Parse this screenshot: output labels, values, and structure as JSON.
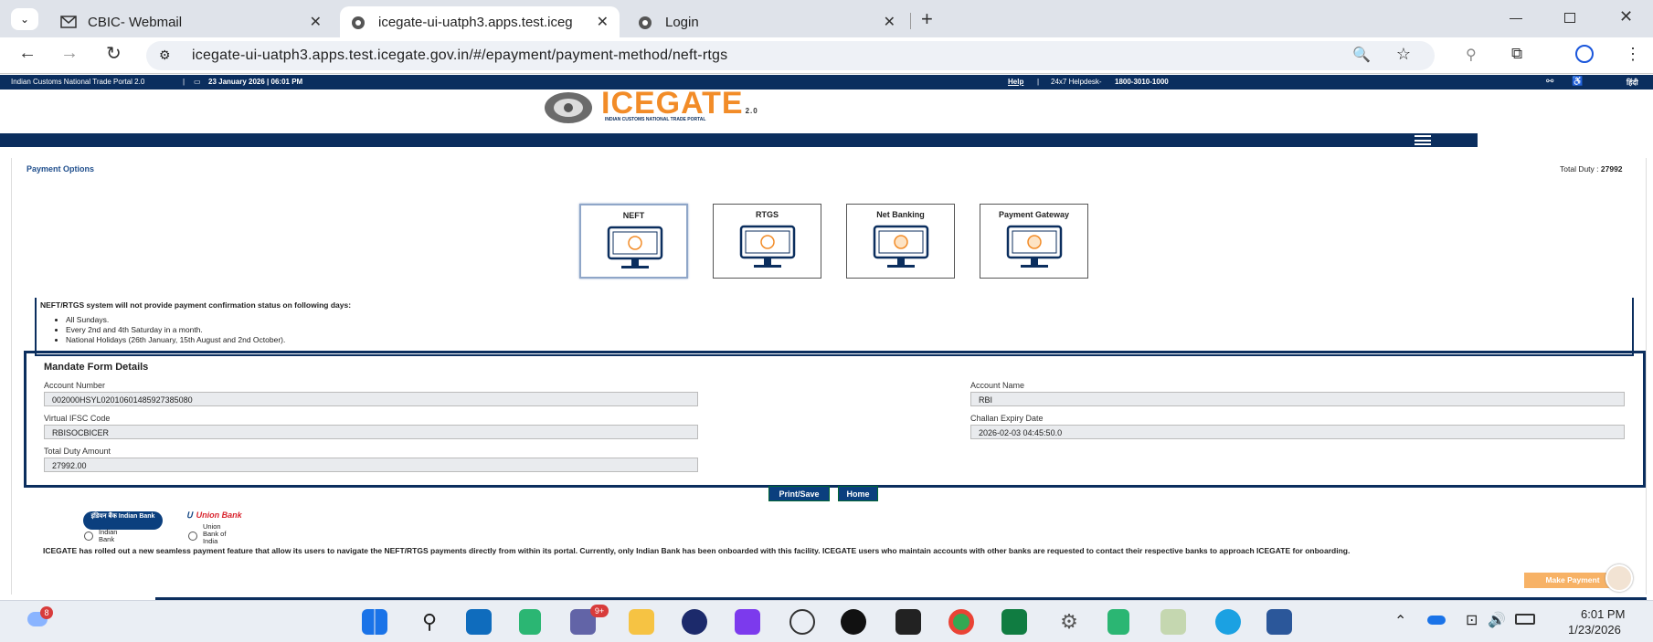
{
  "browser": {
    "tabs": [
      {
        "title": "CBIC- Webmail",
        "active": false
      },
      {
        "title": "icegate-ui-uatph3.apps.test.iceg",
        "active": true
      },
      {
        "title": "Login",
        "active": false
      }
    ],
    "new_tab": "+",
    "url": "icegate-ui-uatph3.apps.test.icegate.gov.in/#/epayment/payment-method/neft-rtgs"
  },
  "topbar": {
    "portal": "Indian Customs National Trade Portal 2.0",
    "date": "23 January 2026 | 06:01 PM",
    "help": "Help",
    "helpdesk_label": "24x7 Helpdesk-",
    "helpdesk_number": "1800-3010-1000",
    "lang": "हिंदी"
  },
  "header": {
    "logo_text": "ICEGATE",
    "logo_ver": "2.0",
    "logo_sub": "INDIAN CUSTOMS NATIONAL TRADE PORTAL"
  },
  "page": {
    "section_title": "Payment Options",
    "total_duty_label": "Total Duty : ",
    "total_duty_value": "27992",
    "methods": [
      {
        "label": "NEFT",
        "selected": true
      },
      {
        "label": "RTGS",
        "selected": false
      },
      {
        "label": "Net Banking",
        "selected": false
      },
      {
        "label": "Payment Gateway",
        "selected": false
      }
    ],
    "notice": {
      "heading": "NEFT/RTGS system will not provide payment confirmation status on following days:",
      "items": [
        "All Sundays.",
        "Every 2nd and 4th Saturday in a month.",
        "National Holidays (26th January, 15th August and 2nd October)."
      ]
    },
    "mandate": {
      "title": "Mandate Form Details",
      "account_number_label": "Account Number",
      "account_number": "002000HSYL02010601485927385080",
      "account_name_label": "Account Name",
      "account_name": "RBI",
      "ifsc_label": "Virtual IFSC Code",
      "ifsc": "RBISOCBICER",
      "expiry_label": "Challan Expiry Date",
      "expiry": "2026-02-03 04:45:50.0",
      "amount_label": "Total Duty Amount",
      "amount": "27992.00"
    },
    "print_button": "Print/Save",
    "home_button": "Home",
    "banks": [
      {
        "name": "Indian Bank",
        "logo": "इंडियन बैंक Indian Bank",
        "radio_label": "Indian Bank"
      },
      {
        "name": "Union Bank",
        "logo": "Union Bank",
        "radio_label": "Union Bank of India"
      }
    ],
    "footer_text": "ICEGATE has rolled out a new seamless payment feature that allow its users to navigate the NEFT/RTGS payments directly from within its portal. Currently, only Indian Bank has been onboarded with this facility. ICEGATE users who maintain accounts with other banks are requested to contact their respective banks to approach ICEGATE for onboarding.",
    "make_payment": "Make Payment"
  },
  "taskbar": {
    "weather_badge": "8",
    "teams_badge": "9+",
    "time": "6:01 PM",
    "date": "1/23/2026"
  },
  "colors": {
    "navy": "#0b2e5e",
    "accent_orange": "#f7a440",
    "tab_bg": "#dfe3ea"
  }
}
